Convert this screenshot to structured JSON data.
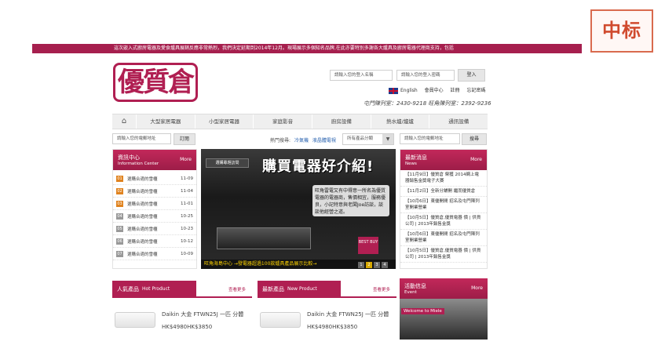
{
  "stamp": "中标",
  "announcement": "這次嵌入式廚房電器及愛食爐具展銷反應非常熱烈，我們決定延期到2014年12月。現場展示多個知名品牌,在此亦要特別多謝各大爐具及廚房電器代理商支持，包括",
  "logo": "優質倉",
  "login": {
    "username_placeholder": "請輸入您的登入名稱",
    "password_placeholder": "請輸入您的登入密碼",
    "login_button": "登入"
  },
  "toplinks": {
    "english": "English",
    "member": "會員中心",
    "register": "註冊",
    "forgot": "忘記密碼"
  },
  "phones": "屯門陳列室：2430-9218  旺角陳列室：2392-9236",
  "nav": {
    "items": [
      "大型家居電器",
      "小型家居電器",
      "家庭影音",
      "廚房設備",
      "熱水爐/爐爐",
      "通訊設備"
    ]
  },
  "subscribe": {
    "placeholder": "請輸入您的電郵地址",
    "button": "訂閱"
  },
  "hot_search": {
    "label": "熱門搜尋:",
    "links": [
      "冷氣機",
      "液晶體電視"
    ],
    "category": "所有產品分類",
    "search_placeholder": "請輸入您的電郵地址",
    "search_button": "搜尋"
  },
  "info_center": {
    "title": "資訊中心",
    "subtitle": "Information Center",
    "more": "More",
    "items": [
      {
        "num": "01",
        "text": "選購合適的雪櫃",
        "date": "11-09"
      },
      {
        "num": "02",
        "text": "選購合適的雪櫃",
        "date": "11-04"
      },
      {
        "num": "03",
        "text": "選購合適的雪櫃",
        "date": "11-01"
      },
      {
        "num": "04",
        "text": "選購合適的雪櫃",
        "date": "10-25"
      },
      {
        "num": "05",
        "text": "選購合適的雪櫃",
        "date": "10-23"
      },
      {
        "num": "06",
        "text": "選購合適的雪櫃",
        "date": "10-12"
      },
      {
        "num": "07",
        "text": "選購合適的雪櫃",
        "date": "10-09"
      }
    ]
  },
  "banner": {
    "tag": "選購專題訪問",
    "title": "購買電器好介紹!",
    "bubble": "旺角雷電又有中得意一所名為優質電器的電器商，售價相宜，服務優良，小記特意與老闆Joe訪談，談談他經營之道。",
    "caption": "旺角海島中心 →發電器超過100款爐具產品展示比較→",
    "best": "BEST BUY",
    "dots": [
      "1",
      "2",
      "3",
      "4"
    ]
  },
  "news": {
    "title": "最新消息",
    "subtitle": "News",
    "more": "More",
    "items": [
      "【11月9日】優質倉 榮獲 2014網上電器銷售金獎電子大賽",
      "【11月2日】全新分舖開 繼而優質倉",
      "【10月6日】東優開間 招名及屯門陳列室開業營業",
      "【10月5日】優質倉,優質電器 價 | 供貨公司 | 2013年銷售金獎",
      "【10月6日】東優開間 招名及屯門陳列室開業營業",
      "【10月5日】優質倉,優質電器 價 | 供貨公司 | 2013年銷售金獎"
    ]
  },
  "hot_product": {
    "title": "人氣產品",
    "subtitle": "Hot Product",
    "more": "查看更多",
    "name": "Daikin 大金 FTWN25J 一匹 分體",
    "price": "HK$4980HK$3850"
  },
  "new_product": {
    "title": "最新產品",
    "subtitle": "New Product",
    "more": "查看更多",
    "name": "Daikin 大金 FTWN25J 一匹 分體",
    "price": "HK$4980HK$3850"
  },
  "event": {
    "title": "活動信息",
    "subtitle": "Event",
    "more": "More",
    "image_caption": "Welcome to Miele"
  }
}
